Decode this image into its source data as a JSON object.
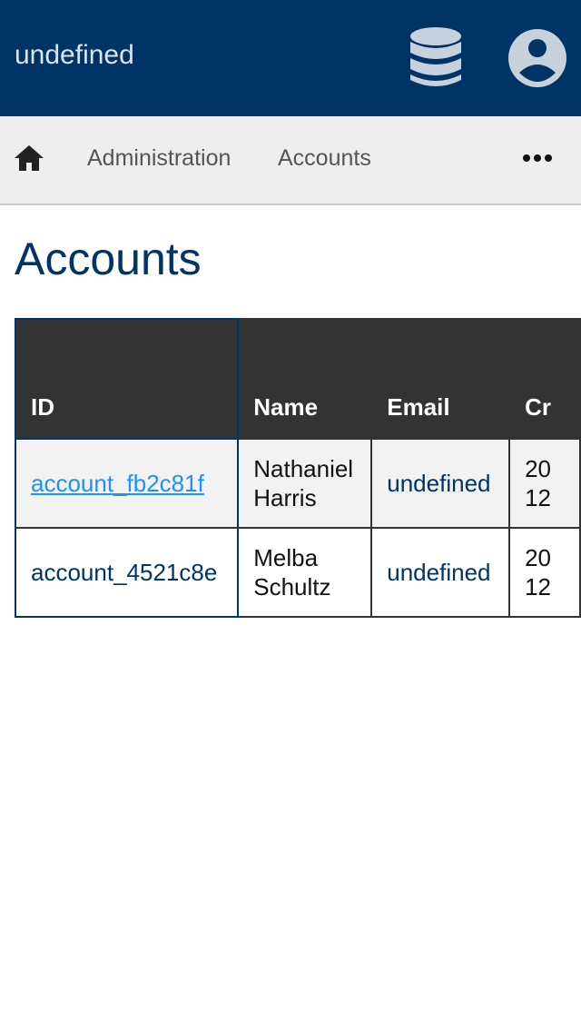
{
  "header": {
    "title": "undefined",
    "icons": {
      "database": "database-icon",
      "user": "account-circle-icon"
    },
    "background": "#003366"
  },
  "nav": {
    "home_icon": "home-icon",
    "items": [
      {
        "label": "Administration"
      },
      {
        "label": "Accounts"
      }
    ],
    "more_icon": "more-horizontal-icon"
  },
  "page": {
    "title": "Accounts"
  },
  "table": {
    "columns": [
      "ID",
      "Name",
      "Email",
      "Cr"
    ],
    "rows": [
      {
        "id": "account_fb2c81f",
        "name_line1": "Nathaniel",
        "name_line2": "Harris",
        "email": "undefined",
        "created_line1": "20",
        "created_line2": "12"
      },
      {
        "id": "account_4521c8e",
        "name_line1": "Melba",
        "name_line2": "Schultz",
        "email": "undefined",
        "created_line1": "20",
        "created_line2": "12"
      }
    ]
  },
  "colors": {
    "brand": "#003366",
    "link": "#1e90ff",
    "table_header": "#333333"
  }
}
